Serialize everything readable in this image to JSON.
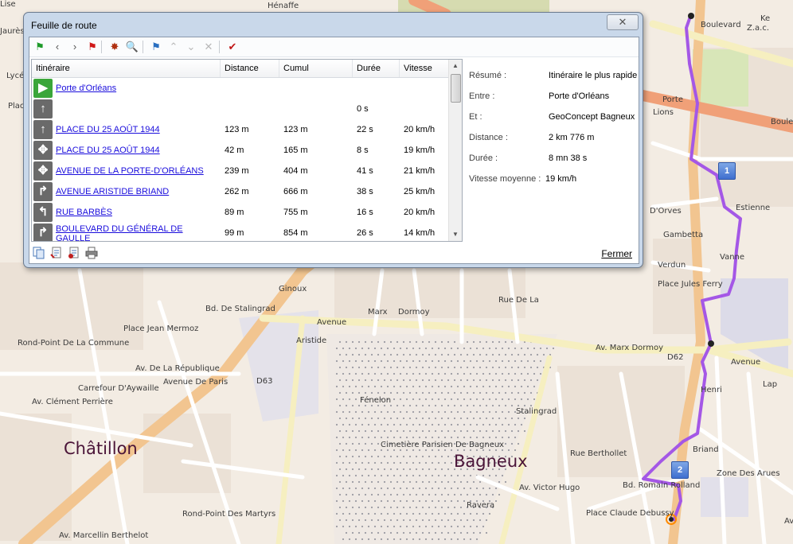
{
  "window": {
    "title": "Feuille de route",
    "close_symbol": "✕"
  },
  "toolbar": {
    "buttons": [
      {
        "name": "start-flag-icon",
        "glyph": "⚑",
        "color": "#1e9a2a"
      },
      {
        "name": "previous-icon",
        "glyph": "‹",
        "color": "#555555"
      },
      {
        "name": "next-icon",
        "glyph": "›",
        "color": "#555555"
      },
      {
        "name": "end-flag-icon",
        "glyph": "⚑",
        "color": "#d01818"
      },
      {
        "name": "route-calc-icon",
        "glyph": "✸",
        "color": "#b03010"
      },
      {
        "name": "zoom-search-icon",
        "glyph": "🔍",
        "color": "#2a6fc0"
      },
      {
        "name": "waypoint-flag-icon",
        "glyph": "⚑",
        "color": "#2a6fc0"
      },
      {
        "name": "move-up-icon",
        "glyph": "⌃",
        "color": "#b8b8b8"
      },
      {
        "name": "move-down-icon",
        "glyph": "⌄",
        "color": "#b8b8b8"
      },
      {
        "name": "delete-icon",
        "glyph": "✕",
        "color": "#b8b8b8"
      },
      {
        "name": "validate-check-icon",
        "glyph": "✔",
        "color": "#c01818"
      }
    ]
  },
  "table": {
    "headers": [
      "Itinéraire",
      "Distance",
      "Cumul",
      "Durée",
      "Vitesse"
    ],
    "rows": [
      {
        "icon": "start-flag",
        "glyph": "▶",
        "bg": "#3aa63a",
        "itineraire": "Porte d'Orléans",
        "distance": "",
        "cumul": "",
        "duree": "",
        "vitesse": "",
        "link": true
      },
      {
        "icon": "straight-arrow",
        "glyph": "↑",
        "bg": "#6a6a6a",
        "itineraire": "",
        "distance": "",
        "cumul": "",
        "duree": "0 s",
        "vitesse": "",
        "link": false
      },
      {
        "icon": "straight-arrow",
        "glyph": "↑",
        "bg": "#6a6a6a",
        "itineraire": "PLACE DU 25 AOÛT 1944",
        "distance": "123 m",
        "cumul": "123 m",
        "duree": "22 s",
        "vitesse": "20 km/h",
        "link": true
      },
      {
        "icon": "roundabout",
        "glyph": "✥",
        "bg": "#6a6a6a",
        "itineraire": "PLACE DU 25 AOÛT 1944",
        "distance": "42 m",
        "cumul": "165 m",
        "duree": "8 s",
        "vitesse": "19 km/h",
        "link": true
      },
      {
        "icon": "roundabout",
        "glyph": "✥",
        "bg": "#6a6a6a",
        "itineraire": "AVENUE DE LA PORTE-D'ORLÉANS",
        "distance": "239 m",
        "cumul": "404 m",
        "duree": "41 s",
        "vitesse": "21 km/h",
        "link": true
      },
      {
        "icon": "turn-right-arrow",
        "glyph": "↱",
        "bg": "#6a6a6a",
        "itineraire": "AVENUE ARISTIDE BRIAND",
        "distance": "262 m",
        "cumul": "666 m",
        "duree": "38 s",
        "vitesse": "25 km/h",
        "link": true
      },
      {
        "icon": "turn-left-arrow",
        "glyph": "↰",
        "bg": "#6a6a6a",
        "itineraire": "RUE BARBÈS",
        "distance": "89 m",
        "cumul": "755 m",
        "duree": "16 s",
        "vitesse": "20 km/h",
        "link": true
      },
      {
        "icon": "turn-right-arrow",
        "glyph": "↱",
        "bg": "#6a6a6a",
        "itineraire": "BOULEVARD DU GÉNÉRAL DE GAULLE",
        "distance": "99 m",
        "cumul": "854 m",
        "duree": "26 s",
        "vitesse": "14 km/h",
        "link": true
      }
    ]
  },
  "summary": [
    {
      "label": "Résumé :",
      "value": "Itinéraire le plus rapide"
    },
    {
      "label": "Entre :",
      "value": "Porte d'Orléans"
    },
    {
      "label": "Et :",
      "value": "GeoConcept Bagneux"
    },
    {
      "label": "Distance :",
      "value": "2 km 776 m"
    },
    {
      "label": "Durée :",
      "value": "8 mn 38 s"
    },
    {
      "label": "Vitesse moyenne :",
      "value": "19 km/h"
    }
  ],
  "bottom": {
    "close_label": "Fermer"
  },
  "map": {
    "cities": [
      "Châtillon",
      "Bagneux"
    ],
    "markers": [
      "1",
      "2"
    ],
    "labels": [
      "Avenue",
      "Marx",
      "Dormoy",
      "Avenue De Paris",
      "Bd. De Stalingrad",
      "Place Jean Mermoz",
      "Rond-Point De La Commune",
      "Carrefour D'Aywaille",
      "Av. Clément Perrière",
      "Cimetière Parisien De Bagneux",
      "Av. Marx Dormoy",
      "D62",
      "Avenue",
      "Lap",
      "Place Jules Ferry",
      "Z.a.c.",
      "Boulevard",
      "Boulevard",
      "Porte",
      "Bd. Romain Rolland",
      "Av. Victor Hugo",
      "Place Claude Debussy",
      "Rond-Point Des Martyrs",
      "Zone Des Arues",
      "Rue Berthollet",
      "Stalingrad",
      "Ravera",
      "Henri",
      "Briand",
      "Aristide",
      "D63",
      "Av. De La République",
      "Av. Marcellin Berthelot",
      "Verdun",
      "Gambetta",
      "D'Orves",
      "Estienne",
      "Vanne",
      "Rue De La",
      "Fénelon",
      "Jaurès",
      "Lycée",
      "Place",
      "Ke",
      "Hénaffe",
      "Lions",
      "Ginoux",
      "Avenue",
      "Lise"
    ]
  }
}
